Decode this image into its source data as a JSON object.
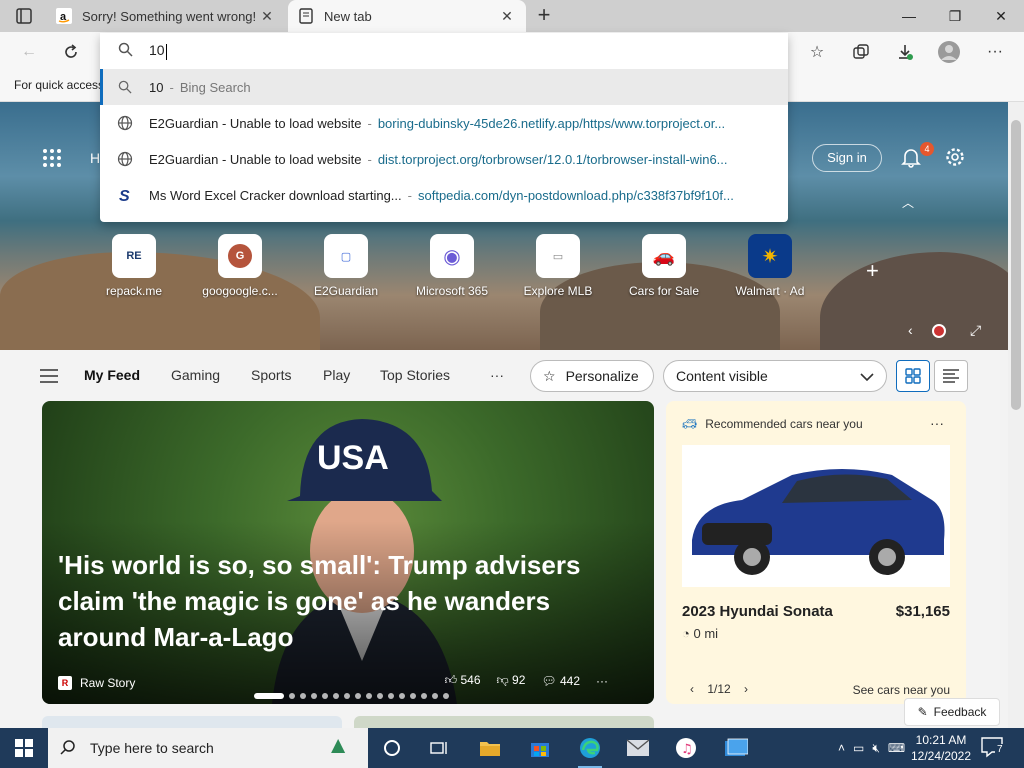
{
  "tabs": [
    {
      "title": "Sorry! Something went wrong!",
      "favicon": "amazon-icon",
      "active": false
    },
    {
      "title": "New tab",
      "favicon": "newtab-icon",
      "active": true
    }
  ],
  "window_controls": {
    "minimize": "—",
    "maximize": "❐",
    "close": "✕"
  },
  "bookmarks_bar": {
    "text": "For quick access"
  },
  "omnibox": {
    "value": "10",
    "suggestions": [
      {
        "icon": "search-icon",
        "title": "10",
        "sep": "-",
        "detail": "Bing Search",
        "selected": true
      },
      {
        "icon": "globe-icon",
        "title": "E2Guardian - Unable to load website",
        "sep": "-",
        "detail": "boring-dubinsky-45de26.netlify.app/https/www.torproject.or..."
      },
      {
        "icon": "globe-icon",
        "title": "E2Guardian - Unable to load website",
        "sep": "-",
        "detail": "dist.torproject.org/torbrowser/12.0.1/torbrowser-install-win6..."
      },
      {
        "icon": "softpedia-icon",
        "title": "Ms Word Excel Cracker download starting...",
        "sep": "-",
        "detail": "softpedia.com/dyn-postdownload.php/c338f37bf9f10f..."
      }
    ]
  },
  "hero": {
    "heading_fragment": "H",
    "signin": "Sign in",
    "notification_count": "4"
  },
  "quick_links": [
    {
      "label": "repack.me",
      "tile": "RE",
      "color": "#1c3b6e"
    },
    {
      "label": "googoogle.c...",
      "tile": "G",
      "color": "#b5543c"
    },
    {
      "label": "E2Guardian",
      "tile": "▢",
      "color": "#3f6ad8"
    },
    {
      "label": "Microsoft 365",
      "tile": "◉",
      "color": "#6b5bd6"
    },
    {
      "label": "Explore MLB",
      "tile": "▭",
      "color": "#888888"
    },
    {
      "label": "Cars for Sale",
      "tile": "🚗",
      "color": "#e04a2b"
    },
    {
      "label": "Walmart · Ad",
      "tile": "✷",
      "color": "#f2b400"
    }
  ],
  "feed_nav": {
    "items": [
      "My Feed",
      "Gaming",
      "Sports",
      "Play",
      "Top Stories"
    ],
    "more": "···",
    "personalize": "Personalize",
    "content_visible": "Content visible"
  },
  "main_story": {
    "headline": "'His world is so, so small': Trump advisers claim 'the magic is gone' as he wanders around Mar-a-Lago",
    "source": "Raw Story",
    "likes": "546",
    "dislikes": "92",
    "comments": "442",
    "more": "···"
  },
  "side_card": {
    "header": "Recommended cars near you",
    "more": "···",
    "title": "2023 Hyundai Sonata",
    "price": "$31,165",
    "mileage": "0 mi",
    "pager": "1/12",
    "see_more": "See cars near you"
  },
  "feedback": "Feedback",
  "taskbar": {
    "search_placeholder": "Type here to search",
    "time": "10:21 AM",
    "date": "12/24/2022",
    "notif_count": "7"
  }
}
